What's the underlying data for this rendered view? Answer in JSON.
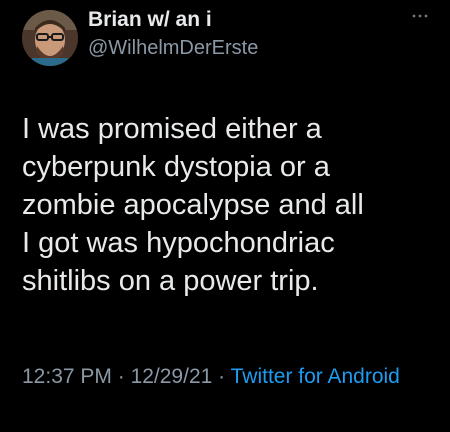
{
  "author": {
    "display_name": "Brian w/ an i",
    "handle": "@WilhelmDerErste",
    "avatar_icon": "profile-photo"
  },
  "more_icon": "more-horizontal-icon",
  "tweet": {
    "text": "I was promised either a\ncyberpunk dystopia or a\nzombie apocalypse and all\nI got was hypochondriac\nshitlibs on a power trip."
  },
  "meta": {
    "time": "12:37 PM",
    "separator1": " · ",
    "date": "12/29/21",
    "separator2": " · ",
    "source": "Twitter for Android"
  },
  "colors": {
    "background": "#000000",
    "text": "#e7e9ea",
    "secondary": "#8b98a5",
    "accent": "#1d9bf0"
  }
}
